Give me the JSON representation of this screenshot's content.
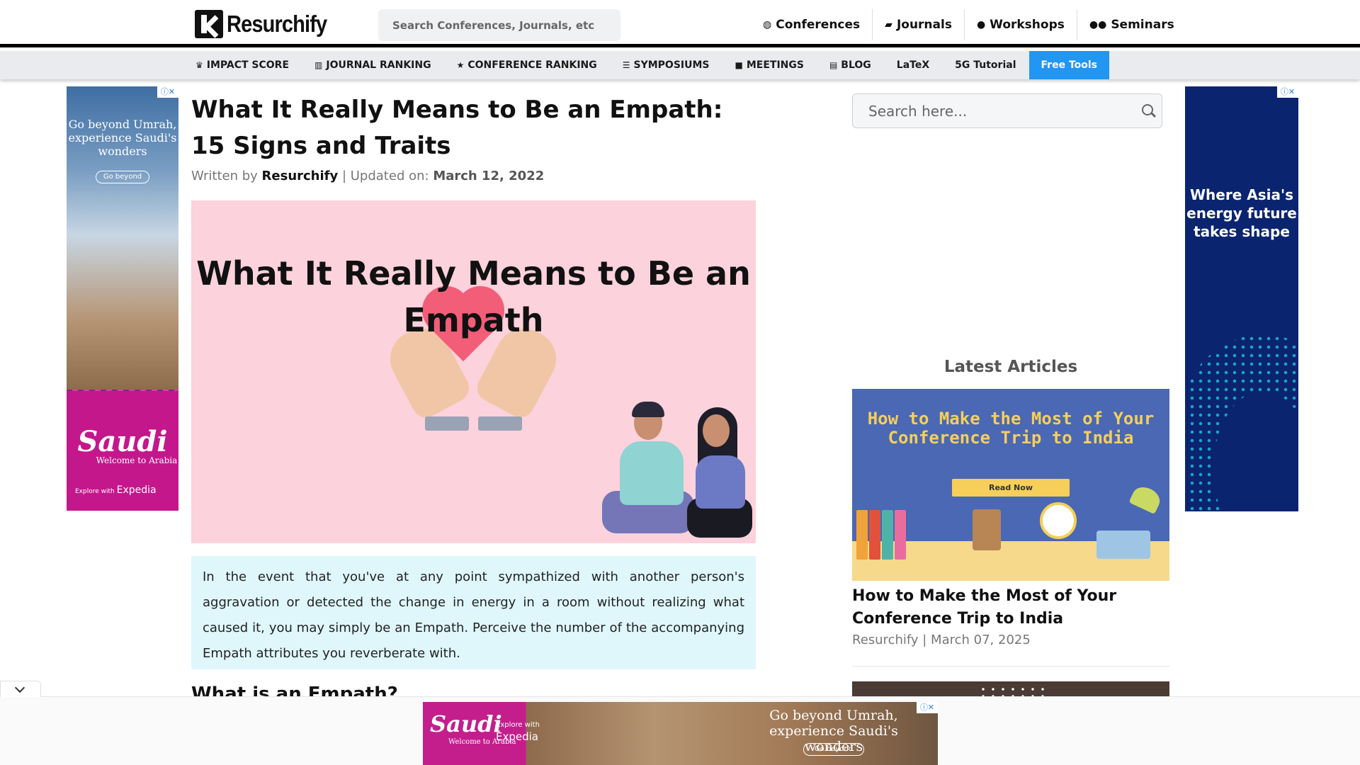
{
  "header": {
    "logo_text": "Resurchify",
    "search_placeholder": "Search Conferences, Journals, etc",
    "nav": [
      {
        "icon": "globe-icon",
        "glyph": "◍",
        "label": "Conferences"
      },
      {
        "icon": "book-icon",
        "glyph": "▰",
        "label": "Journals"
      },
      {
        "icon": "user-icon",
        "glyph": "●",
        "label": "Workshops"
      },
      {
        "icon": "users-icon",
        "glyph": "●●",
        "label": "Seminars"
      }
    ]
  },
  "subnav": {
    "items": [
      {
        "icon": "trophy-icon",
        "glyph": "♛",
        "label": "IMPACT SCORE"
      },
      {
        "icon": "bar-chart-icon",
        "glyph": "▥",
        "label": "JOURNAL RANKING"
      },
      {
        "icon": "star-icon",
        "glyph": "★",
        "label": "CONFERENCE RANKING"
      },
      {
        "icon": "list-icon",
        "glyph": "☰",
        "label": "SYMPOSIUMS"
      },
      {
        "icon": "briefcase-icon",
        "glyph": "■",
        "label": "MEETINGS"
      },
      {
        "icon": "newspaper-icon",
        "glyph": "▤",
        "label": "BLOG"
      },
      {
        "icon": "",
        "glyph": "",
        "label": "LaTeX"
      },
      {
        "icon": "",
        "glyph": "",
        "label": "5G Tutorial"
      },
      {
        "icon": "",
        "glyph": "",
        "label": "Free Tools",
        "active": true
      }
    ],
    "accent": "#2196f3"
  },
  "article": {
    "title": "What It Really Means to Be an Empath: 15 Signs and Traits",
    "written_by_label": "Written by",
    "author": "Resurchify",
    "updated_label": "| Updated on:",
    "updated_date": "March 12, 2022",
    "hero_title": "What It Really Means to Be an Empath",
    "intro": "In the event that you've at any point sympathized with another person's aggravation or detected the change in energy in a room without realizing what caused it, you may simply be an Empath. Perceive the number of the accompanying Empath attributes you reverberate with.",
    "section_heading": "What is an Empath?",
    "hero_bg": "#fcd2dc",
    "intro_bg": "#dff7fb"
  },
  "sidebar": {
    "search_placeholder": "Search here...",
    "latest_title": "Latest Articles",
    "card": {
      "image_title": "How to Make the Most of Your Conference Trip to India",
      "image_button": "Read Now",
      "title": "How to Make the Most of Your Conference Trip to India",
      "meta": "Resurchify | March 07, 2025"
    }
  },
  "ads": {
    "left": {
      "copy": "Go beyond Umrah, experience Saudi's wonders",
      "button": "Go beyond",
      "brand": "Saudi",
      "welcome": "Welcome to Arabia",
      "explore": "Explore with",
      "partner": "Expedia"
    },
    "right": {
      "copy": "Where Asia's energy future takes shape"
    },
    "bottom": {
      "brand": "Saudi",
      "welcome": "Welcome to Arabia",
      "explore": "Explore with",
      "partner": "Expedia",
      "copy": "Go beyond Umrah, experience Saudi's wonders",
      "button": "Go beyond"
    },
    "close_glyph": "ⓘ✕"
  }
}
